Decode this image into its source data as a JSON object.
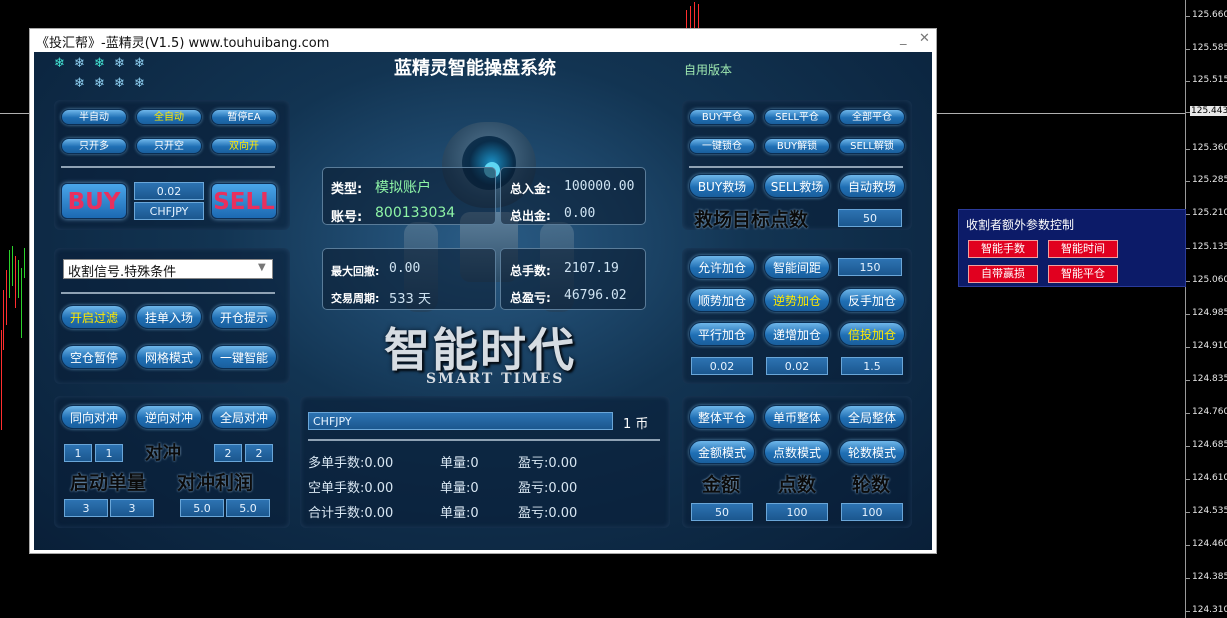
{
  "window": {
    "title": "《投汇帮》-蓝精灵(V1.5) www.touhuibang.com",
    "minimize": "_",
    "close": "✕"
  },
  "header": {
    "title": "蓝精灵智能操盘系统",
    "version": "自用版本"
  },
  "left": {
    "mode_buttons": [
      "半自动",
      "全自动",
      "暂停EA",
      "只开多",
      "只开空",
      "双向开"
    ],
    "buy": "BUY",
    "sell": "SELL",
    "lot": "0.02",
    "symbol": "CHFJPY",
    "signal_select": "收割信号.特殊条件",
    "feature_buttons": [
      "开启过滤",
      "挂单入场",
      "开仓提示",
      "空仓暂停",
      "网格模式",
      "一键智能"
    ],
    "hedge_buttons": [
      "同向对冲",
      "逆向对冲",
      "全局对冲"
    ],
    "hedge_label": "对冲",
    "hedge_inputs": [
      "1",
      "1",
      "2",
      "2"
    ],
    "start_lot_label": "启动单量",
    "hedge_profit_label": "对冲利润",
    "start_lot_inputs": [
      "3",
      "3"
    ],
    "hedge_profit_inputs": [
      "5.0",
      "5.0"
    ]
  },
  "center": {
    "type_label": "类型:",
    "type_value": "模拟账户",
    "account_label": "账号:",
    "account_value": "800133034",
    "deposit_label": "总入金:",
    "deposit_value": "100000.00",
    "withdraw_label": "总出金:",
    "withdraw_value": "0.00",
    "max_drawdown_label": "最大回撤:",
    "max_drawdown_value": "0.00",
    "trade_period_label": "交易周期:",
    "trade_period_value": "533 天",
    "total_lots_label": "总手数:",
    "total_lots_value": "2107.19",
    "total_profit_label": "总盈亏:",
    "total_profit_value": "46796.02",
    "logo_cn": "智能时代",
    "logo_en": "SMART TIMES",
    "symbol_field": "CHFJPY",
    "currency_count": "1 币",
    "rows": [
      {
        "a": "多单手数:0.00",
        "b": "单量:0",
        "c": "盈亏:0.00"
      },
      {
        "a": "空单手数:0.00",
        "b": "单量:0",
        "c": "盈亏:0.00"
      },
      {
        "a": "合计手数:0.00",
        "b": "单量:0",
        "c": "盈亏:0.00"
      }
    ]
  },
  "right": {
    "close_buttons": [
      "BUY平仓",
      "SELL平仓",
      "全部平仓",
      "一键锁仓",
      "BUY解锁",
      "SELL解锁"
    ],
    "rescue_buttons": [
      "BUY救场",
      "SELL救场",
      "自动救场"
    ],
    "rescue_target_label": "救场目标点数",
    "rescue_target_value": "50",
    "add_buttons": [
      "允许加仓",
      "智能间距",
      "顺势加仓",
      "逆势加仓",
      "反手加仓",
      "平行加仓",
      "递增加仓",
      "倍投加仓"
    ],
    "spacing_value": "150",
    "add_inputs": [
      "0.02",
      "0.02",
      "1.5"
    ],
    "overall_buttons": [
      "整体平仓",
      "单币整体",
      "全局整体",
      "金额模式",
      "点数模式",
      "轮数模式"
    ],
    "overall_labels": [
      "金额",
      "点数",
      "轮数"
    ],
    "overall_inputs": [
      "50",
      "100",
      "100"
    ]
  },
  "outer_panel": {
    "title": "收割者额外参数控制",
    "buttons": [
      "智能手数",
      "智能时间",
      "自带赢损",
      "智能平仓"
    ]
  },
  "price_axis": {
    "labels": [
      "125.660",
      "125.585",
      "125.515",
      "125.443",
      "125.360",
      "125.285",
      "125.210",
      "125.135",
      "125.060",
      "124.985",
      "124.910",
      "124.835",
      "124.760",
      "124.685",
      "124.610",
      "124.535",
      "124.460",
      "124.385",
      "124.310"
    ],
    "current": "125.443"
  },
  "colors": {
    "accent_yellow": "#ffe800",
    "buy_sell_text": "#e8305e",
    "outer_button": "#e1001f",
    "panel_dark": "#091f38"
  }
}
